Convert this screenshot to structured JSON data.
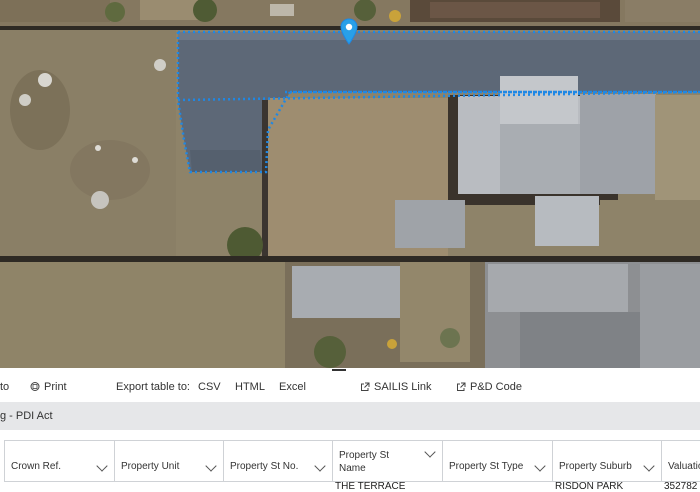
{
  "toolbar": {
    "partial_label": "to",
    "print_label": "Print",
    "export_label": "Export table to:",
    "csv_label": "CSV",
    "html_label": "HTML",
    "excel_label": "Excel",
    "sailis_label": "SAILIS Link",
    "pd_label": "P&D Code"
  },
  "section": {
    "title": "g - PDI Act"
  },
  "table": {
    "headers": [
      "Crown Ref.",
      "Property Unit",
      "Property St No.",
      "Property St Name",
      "Property St Type",
      "Property Suburb",
      "Valuatio"
    ],
    "row": [
      "",
      "",
      "",
      "THE TERRACE",
      "",
      "RISDON PARK",
      "352782"
    ]
  },
  "map": {
    "marker_icon": "location-pin-icon",
    "selection_color": "#1e88e5"
  },
  "colors": {
    "band": "#e6e7e9",
    "accent": "#1e88e5"
  }
}
